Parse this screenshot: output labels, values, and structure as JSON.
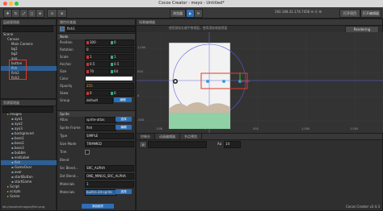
{
  "window": {
    "title": "Cocos Creator - meyo - Untitled*"
  },
  "toolbar": {
    "buttons": [
      "",
      "",
      "",
      "",
      ""
    ],
    "preview_label": "浏览器",
    "ip_text": "192.168.31.174:7456 ✉ ⓦ ⚙",
    "open_project_label": "打开项目",
    "open_editor_label": "打开编辑器"
  },
  "hierarchy": {
    "title": "层级管理器",
    "items": [
      {
        "label": "Scene",
        "depth": 0
      },
      {
        "label": "Canvas",
        "depth": 1
      },
      {
        "label": "Main Camera",
        "depth": 2
      },
      {
        "label": "bg1",
        "depth": 2
      },
      {
        "label": "bg2",
        "depth": 2
      },
      {
        "label": "ayo",
        "depth": 2
      },
      {
        "label": "button",
        "depth": 2
      },
      {
        "label": "fish",
        "depth": 2
      },
      {
        "label": "fish2",
        "depth": 2
      },
      {
        "label": "fish3",
        "depth": 2
      }
    ]
  },
  "assets": {
    "title": "资源管理器",
    "items": [
      {
        "label": "images",
        "depth": 1
      },
      {
        "label": "ayo1",
        "depth": 2
      },
      {
        "label": "ayo2",
        "depth": 2
      },
      {
        "label": "ayo3",
        "depth": 2
      },
      {
        "label": "background",
        "depth": 2
      },
      {
        "label": "boss1",
        "depth": 2
      },
      {
        "label": "boss2",
        "depth": 2
      },
      {
        "label": "boss3",
        "depth": 2
      },
      {
        "label": "bubble",
        "depth": 2
      },
      {
        "label": "endLabel",
        "depth": 2
      },
      {
        "label": "fish",
        "depth": 2
      },
      {
        "label": "GameOver",
        "depth": 2
      },
      {
        "label": "over",
        "depth": 2
      },
      {
        "label": "startButton",
        "depth": 2
      },
      {
        "label": "startGame",
        "depth": 2
      },
      {
        "label": "Script",
        "depth": 1
      },
      {
        "label": "scripts",
        "depth": 1
      },
      {
        "label": "Scene",
        "depth": 1
      }
    ],
    "status": "db://assets/images/fish.png"
  },
  "inspector": {
    "title": "属性检查器",
    "node_name": "fish1",
    "node_section": "Node",
    "props": [
      {
        "label": "Position",
        "x": "300",
        "y": "0"
      },
      {
        "label": "Rotation",
        "value": "0"
      },
      {
        "label": "Scale",
        "x": "1",
        "y": "1"
      },
      {
        "label": "Anchor",
        "x": "0.5",
        "y": "0.5"
      },
      {
        "label": "Size",
        "x": "70",
        "y": "64"
      },
      {
        "label": "Color"
      },
      {
        "label": "Opacity",
        "value": "255"
      },
      {
        "label": "Skew",
        "x": "0",
        "y": "0"
      },
      {
        "label": "Group",
        "value": "default"
      }
    ],
    "edit_label": "编辑",
    "sprite_section": "Sprite",
    "sprite_props": [
      {
        "label": "Atlas",
        "value": "sprite-atlas"
      },
      {
        "label": "Sprite Frame",
        "value": "fish"
      },
      {
        "label": "Type",
        "value": "SIMPLE"
      },
      {
        "label": "Size Mode",
        "value": "TRIMMED"
      },
      {
        "label": "Trim",
        "value": ""
      },
      {
        "label": "Blend",
        "value": ""
      },
      {
        "label": "Src Blend...",
        "value": "SRC_ALPHA"
      },
      {
        "label": "Dst Blend...",
        "value": "ONE_MINUS_SRC_ALPHA"
      },
      {
        "label": "Materials",
        "value": "1"
      },
      {
        "label": "Materials",
        "value": "builtin-2d-sprite"
      }
    ],
    "select_label": "选择",
    "add_component_label": "添加组件"
  },
  "scene": {
    "title": "场景编辑器",
    "hint": "使用鼠标右键平移视窗，使用滚轮缩放视窗",
    "rendering_label": "Rendering",
    "y_ticks": [
      "1,000",
      "500",
      "0",
      "-500"
    ],
    "x_ticks": [
      "-500",
      "0",
      "500",
      "1,000",
      "1,500"
    ]
  },
  "console": {
    "tabs": [
      "控制台",
      "动画编辑器",
      "节点预览"
    ],
    "filter_placeholder": "",
    "font_size_label": "Aa",
    "font_size_value": "14"
  },
  "footer": {
    "version": "Cocos Creator v2.4.3"
  },
  "colors": {
    "accent": "#2d6fb8",
    "highlight": "#e03b2b",
    "selected_row": "#2d5f94"
  }
}
